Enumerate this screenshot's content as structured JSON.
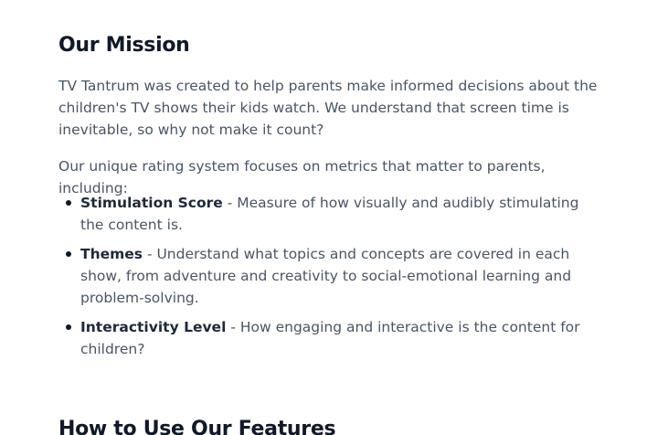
{
  "mission": {
    "title": "Our Mission",
    "intro": "TV Tantrum was created to help parents make informed decisions about the children's TV shows their kids watch. We understand that screen time is inevitable, so why not make it count?",
    "rating_intro": "Our unique rating system focuses on metrics that matter to parents, including:",
    "features": [
      {
        "name": "Stimulation Score",
        "description": " - Measure of how visually and audibly stimulating the content is."
      },
      {
        "name": "Themes",
        "description": " - Understand what topics and concepts are covered in each show, from adventure and creativity to social-emotional learning and problem-solving."
      },
      {
        "name": "Interactivity Level",
        "description": " - How engaging and interactive is the content for children?"
      }
    ]
  },
  "how_to": {
    "title": "How to Use Our Features"
  }
}
